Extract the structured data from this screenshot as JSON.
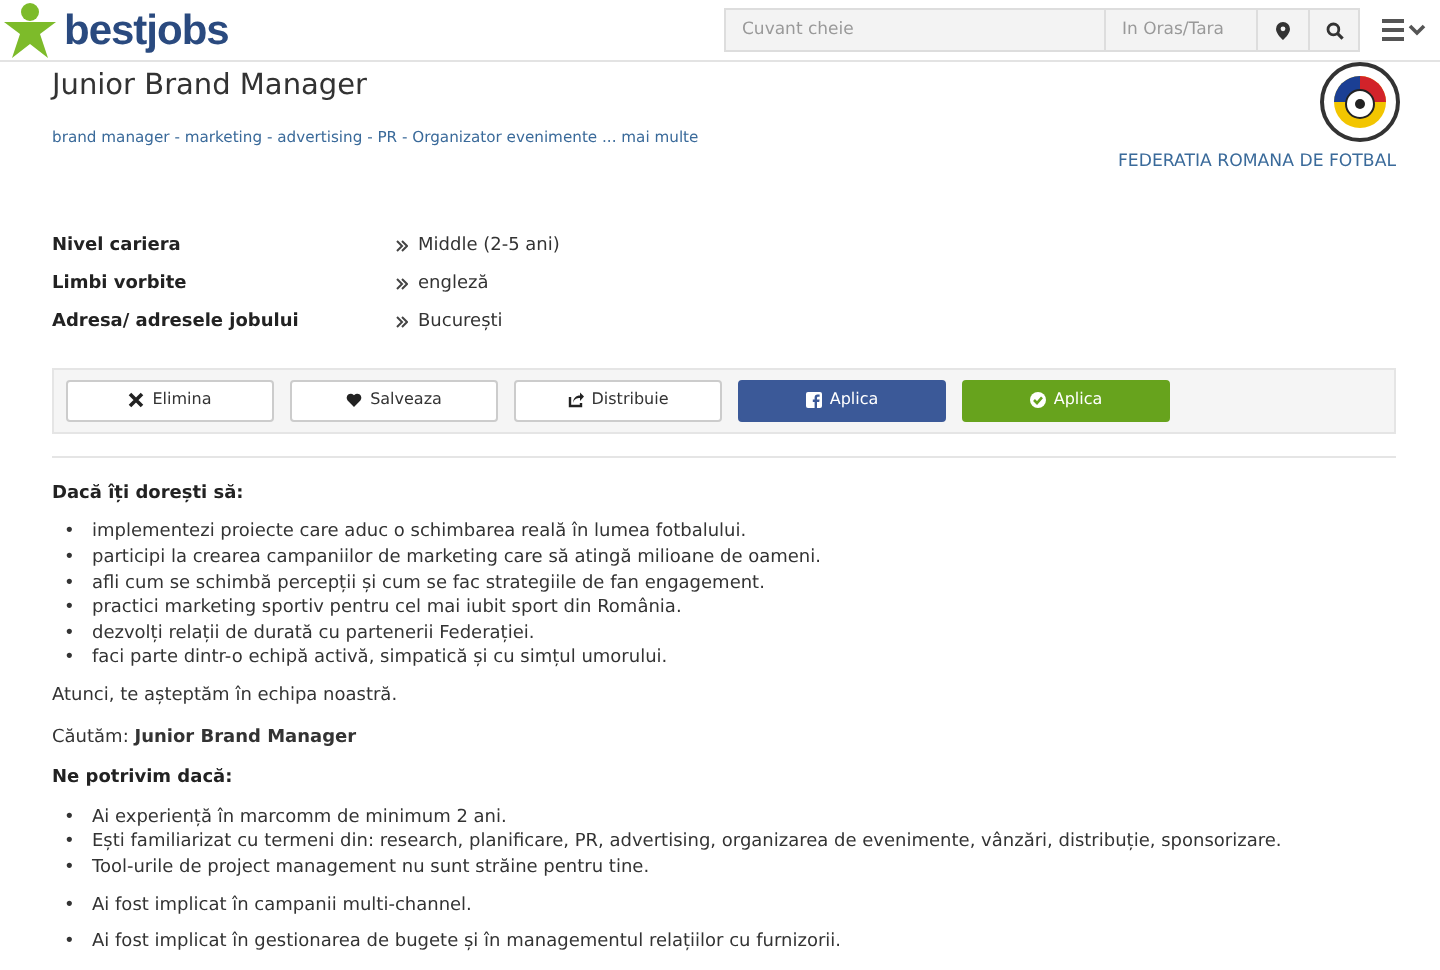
{
  "header": {
    "logo": "bestjobs",
    "search": {
      "placeholder": "Cuvant cheie"
    },
    "location": {
      "placeholder": "In Oras/Tara"
    }
  },
  "job": {
    "title": "Junior Brand Manager",
    "tags": "brand manager - marketing - advertising - PR - Organizator evenimente ... mai multe",
    "company": "FEDERATIA ROMANA DE FOTBAL"
  },
  "details": [
    {
      "label": "Nivel cariera",
      "value": "Middle (2-5 ani)"
    },
    {
      "label": "Limbi vorbite",
      "value": "engleză"
    },
    {
      "label": "Adresa/ adresele jobului",
      "value": "București"
    }
  ],
  "actions": [
    {
      "kind": "remove",
      "label": "Elimina"
    },
    {
      "kind": "save",
      "label": "Salveaza"
    },
    {
      "kind": "share",
      "label": "Distribuie"
    },
    {
      "kind": "facebook",
      "label": "Aplica"
    },
    {
      "kind": "apply",
      "label": "Aplica"
    }
  ],
  "description": [
    {
      "kind": "heading",
      "text": "Dacă îți dorești să:"
    },
    {
      "kind": "list",
      "bullet": "•",
      "items": [
        "implementezi proiecte care aduc o schimbarea reală în lumea fotbalului.",
        "participi la crearea campaniilor de marketing care să atingă milioane de oameni.",
        "afli cum se schimbă percepții și cum se fac strategiile de fan engagement.",
        "practici marketing sportiv pentru cel mai iubit sport din România.",
        "dezvolți relații de durată cu partenerii Federației.",
        "faci parte dintr-o echipă activă, simpatică și cu simțul umorului."
      ]
    },
    {
      "kind": "paragraph",
      "text": "Atunci, te așteptăm în echipa noastră."
    },
    {
      "kind": "paragraph",
      "text": "Căutăm: **Junior Brand Manager**"
    },
    {
      "kind": "heading",
      "text": "Ne potrivim dacă:"
    },
    {
      "kind": "list",
      "bullet": "•",
      "items": [
        "Ai experiență în marcomm de minimum 2 ani.",
        "Ești familiarizat cu termeni din: research, planificare, PR, advertising, organizarea de evenimente, vânzări, distribuție, sponsorizare.",
        "Tool-urile de project management nu sunt străine pentru tine."
      ]
    },
    {
      "kind": "list",
      "bullet": "•",
      "items": [
        "Ai fost implicat în campanii multi-channel."
      ]
    },
    {
      "kind": "list",
      "bullet": "•",
      "items": [
        "Ai fost implicat în gestionarea de bugete și în managementul relațiilor cu furnizorii."
      ]
    }
  ]
}
